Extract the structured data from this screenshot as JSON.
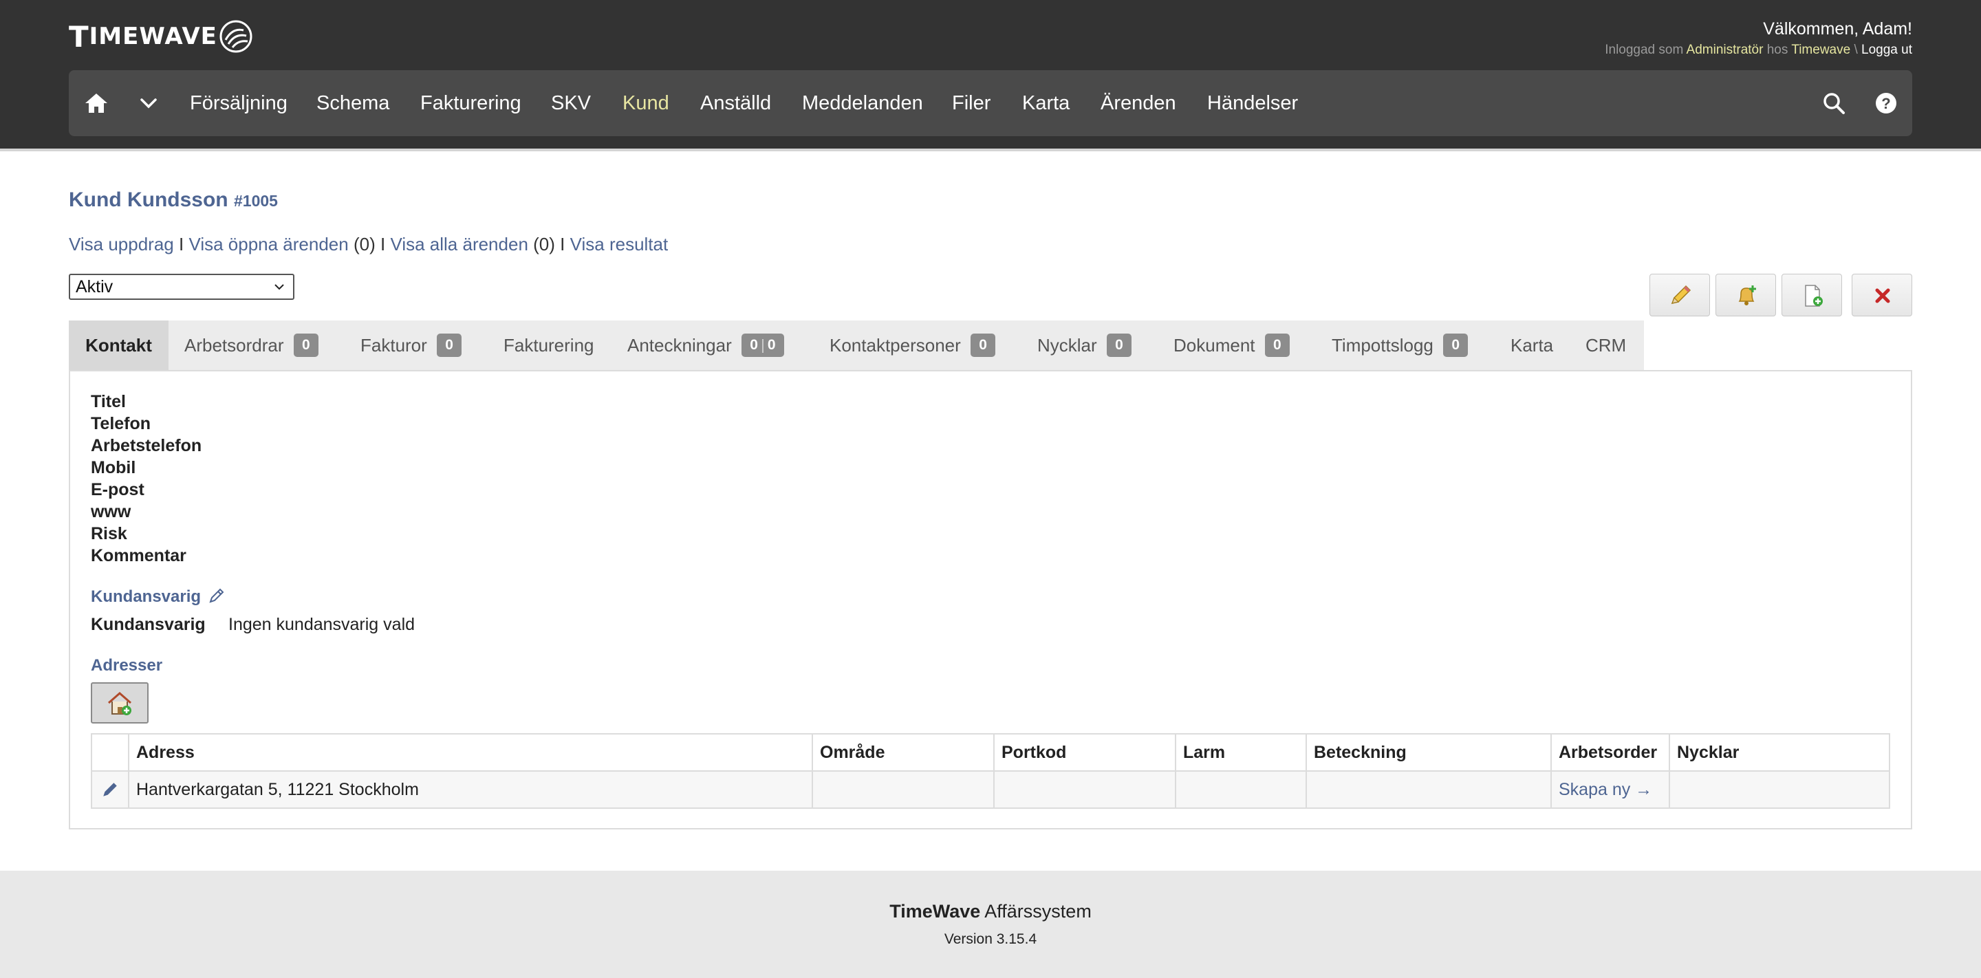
{
  "header": {
    "logo_text_big": "T",
    "logo_text_rest": "IMEWAVE",
    "welcome": "Välkommen, Adam!",
    "login_prefix": "Inloggad som",
    "login_role": "Administratör",
    "login_mid": "hos",
    "login_company": "Timewave",
    "login_sep": "\\",
    "logout": "Logga ut"
  },
  "nav": {
    "items": [
      {
        "label": "Försäljning"
      },
      {
        "label": "Schema"
      },
      {
        "label": "Fakturering"
      },
      {
        "label": "SKV"
      },
      {
        "label": "Kund",
        "active": true
      },
      {
        "label": "Anställd"
      },
      {
        "label": "Meddelanden"
      },
      {
        "label": "Filer"
      },
      {
        "label": "Karta"
      },
      {
        "label": "Ärenden"
      },
      {
        "label": "Händelser"
      }
    ],
    "active_color": "#e8e6a2"
  },
  "customer": {
    "name": "Kund Kundsson",
    "number": "#1005"
  },
  "links": {
    "show_assignments": "Visa uppdrag",
    "sep": "I",
    "show_open_cases": "Visa öppna ärenden",
    "open_cases_count": "(0)",
    "show_all_cases": "Visa alla ärenden",
    "all_cases_count": "(0)",
    "show_results": "Visa resultat"
  },
  "status": {
    "selected": "Aktiv"
  },
  "tabs": [
    {
      "label": "Kontakt",
      "active": true
    },
    {
      "label": "Arbetsordrar",
      "badge": "0"
    },
    {
      "label": "Fakturor",
      "badge": "0"
    },
    {
      "label": "Fakturering"
    },
    {
      "label": "Anteckningar",
      "badge": "0",
      "badge2": "0"
    },
    {
      "label": "Kontaktpersoner",
      "badge": "0"
    },
    {
      "label": "Nycklar",
      "badge": "0"
    },
    {
      "label": "Dokument",
      "badge": "0"
    },
    {
      "label": "Timpottslogg",
      "badge": "0"
    },
    {
      "label": "Karta"
    },
    {
      "label": "CRM"
    }
  ],
  "contact_fields": [
    "Titel",
    "Telefon",
    "Arbetstelefon",
    "Mobil",
    "E-post",
    "www",
    "Risk",
    "Kommentar"
  ],
  "responsible": {
    "heading": "Kundansvarig",
    "label": "Kundansvarig",
    "value": "Ingen kundansvarig vald"
  },
  "addresses": {
    "heading": "Adresser",
    "columns": [
      "",
      "Adress",
      "Område",
      "Portkod",
      "Larm",
      "Beteckning",
      "Arbetsorder",
      "Nycklar"
    ],
    "rows": [
      {
        "address": "Hantverkargatan 5, 11221 Stockholm",
        "area": "",
        "portcode": "",
        "alarm": "",
        "designation": "",
        "work_order": "Skapa ny →",
        "keys": ""
      }
    ]
  },
  "footer": {
    "brand": "TimeWave",
    "system": "Affärssystem",
    "version": "Version 3.15.4"
  },
  "colors": {
    "header_bg": "#333333",
    "navbar_bg": "#4a4a4a",
    "link": "#4e6592",
    "badge": "#8c8c8c"
  }
}
